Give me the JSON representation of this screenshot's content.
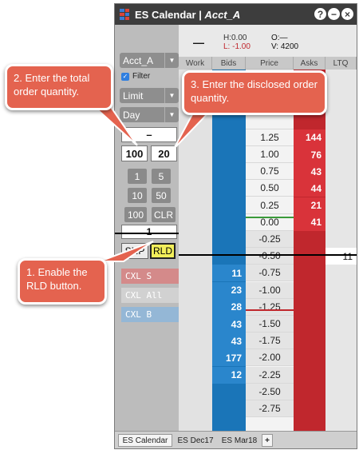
{
  "window": {
    "title_prefix": "ES Calendar | ",
    "title_account": "Acct_A",
    "buttons": {
      "help": "?",
      "minimize": "−",
      "close": "×"
    }
  },
  "stats": {
    "dash": "—",
    "high": "H:0.00",
    "low": "L: -1.00",
    "open": "O:—",
    "volume": "V: 4200"
  },
  "left_panel": {
    "account": "Acct_A",
    "filter_label": "Filter",
    "order_type": "Limit",
    "duration": "Day",
    "price_field": "–",
    "total_qty": "100",
    "disclosed_qty": "20",
    "qty_buttons": [
      "1",
      "5",
      "10",
      "50",
      "100",
      "CLR"
    ],
    "default_qty": "1",
    "snp_label": "SNP",
    "rld_label": "RLD",
    "cxl_sell": "CXL S",
    "cxl_all": "CXL All",
    "cxl_buy": "CXL B"
  },
  "columns": [
    "Work",
    "Bids",
    "Price",
    "Asks",
    "LTQ"
  ],
  "ladder": [
    {
      "price": "",
      "bid": "",
      "ask": ""
    },
    {
      "price": "",
      "bid": "",
      "ask": ""
    },
    {
      "price": "",
      "bid": "",
      "ask": ""
    },
    {
      "price": "",
      "bid": "",
      "ask": ""
    },
    {
      "price": "1.25",
      "bid": "",
      "ask": "144"
    },
    {
      "price": "1.00",
      "bid": "",
      "ask": "76"
    },
    {
      "price": "0.75",
      "bid": "",
      "ask": "43"
    },
    {
      "price": "0.50",
      "bid": "",
      "ask": "44"
    },
    {
      "price": "0.25",
      "bid": "",
      "ask": "21"
    },
    {
      "price": "0.00",
      "bid": "",
      "ask": "41"
    },
    {
      "price": "-0.25",
      "bid": "",
      "ask": ""
    },
    {
      "price": "-0.50",
      "bid": "",
      "ask": "",
      "ltq": "11"
    },
    {
      "price": "-0.75",
      "bid": "11",
      "ask": ""
    },
    {
      "price": "-1.00",
      "bid": "23",
      "ask": ""
    },
    {
      "price": "-1.25",
      "bid": "28",
      "ask": ""
    },
    {
      "price": "-1.50",
      "bid": "43",
      "ask": ""
    },
    {
      "price": "-1.75",
      "bid": "43",
      "ask": ""
    },
    {
      "price": "-2.00",
      "bid": "177",
      "ask": ""
    },
    {
      "price": "-2.25",
      "bid": "12",
      "ask": ""
    },
    {
      "price": "-2.50",
      "bid": "",
      "ask": ""
    },
    {
      "price": "-2.75",
      "bid": "",
      "ask": ""
    }
  ],
  "tabs": [
    "ES Calendar",
    "ES Dec17",
    "ES Mar18",
    "+"
  ],
  "callouts": {
    "step1": "1. Enable the RLD button.",
    "step2": "2. Enter the total order quantity.",
    "step3": "3. Enter the disclosed order quantity."
  },
  "colors": {
    "bid_blue": "#1a75b8",
    "ask_red": "#c0272d",
    "callout": "#e4634f",
    "rld_yellow": "#f2ef5a"
  }
}
